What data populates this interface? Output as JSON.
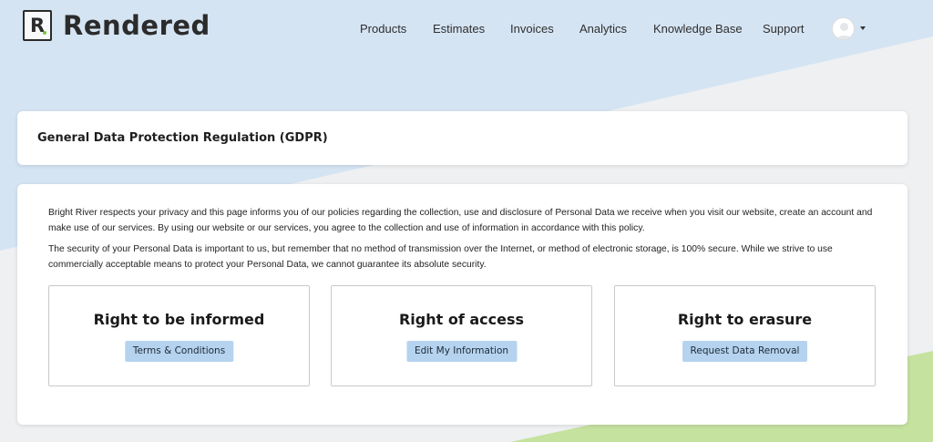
{
  "colors": {
    "background": "#eef0f2",
    "blue_band": "#d5e4f3",
    "green_band": "#c6e29f",
    "button_bg": "#b5d3ef",
    "logo_accent": "#7fc243"
  },
  "header": {
    "logo_letter": "R",
    "logo_text": "Rendered",
    "nav": [
      {
        "label": "Products"
      },
      {
        "label": "Estimates"
      },
      {
        "label": "Invoices"
      },
      {
        "label": "Analytics"
      },
      {
        "label": "Knowledge Base"
      },
      {
        "label": "Support"
      }
    ],
    "avatar_icon": "user-avatar-icon",
    "menu_icon": "caret-down-icon"
  },
  "title_card": {
    "title": "General Data Protection Regulation (GDPR)"
  },
  "main": {
    "paragraphs": [
      "Bright River respects your privacy and this page informs you of our policies regarding the collection, use and disclosure of Personal Data we receive when you visit our website, create an account and make use of our services. By using our website or our services, you agree to the collection and use of information in accordance with this policy.",
      "The security of your Personal Data is important to us, but remember that no method of transmission over the Internet, or method of electronic storage, is 100% secure. While we strive to use commercially acceptable means to protect your Personal Data, we cannot guarantee its absolute security."
    ],
    "rights": [
      {
        "title": "Right to be informed",
        "button": "Terms & Conditions"
      },
      {
        "title": "Right of access",
        "button": "Edit My Information"
      },
      {
        "title": "Right to erasure",
        "button": "Request Data Removal"
      }
    ]
  }
}
